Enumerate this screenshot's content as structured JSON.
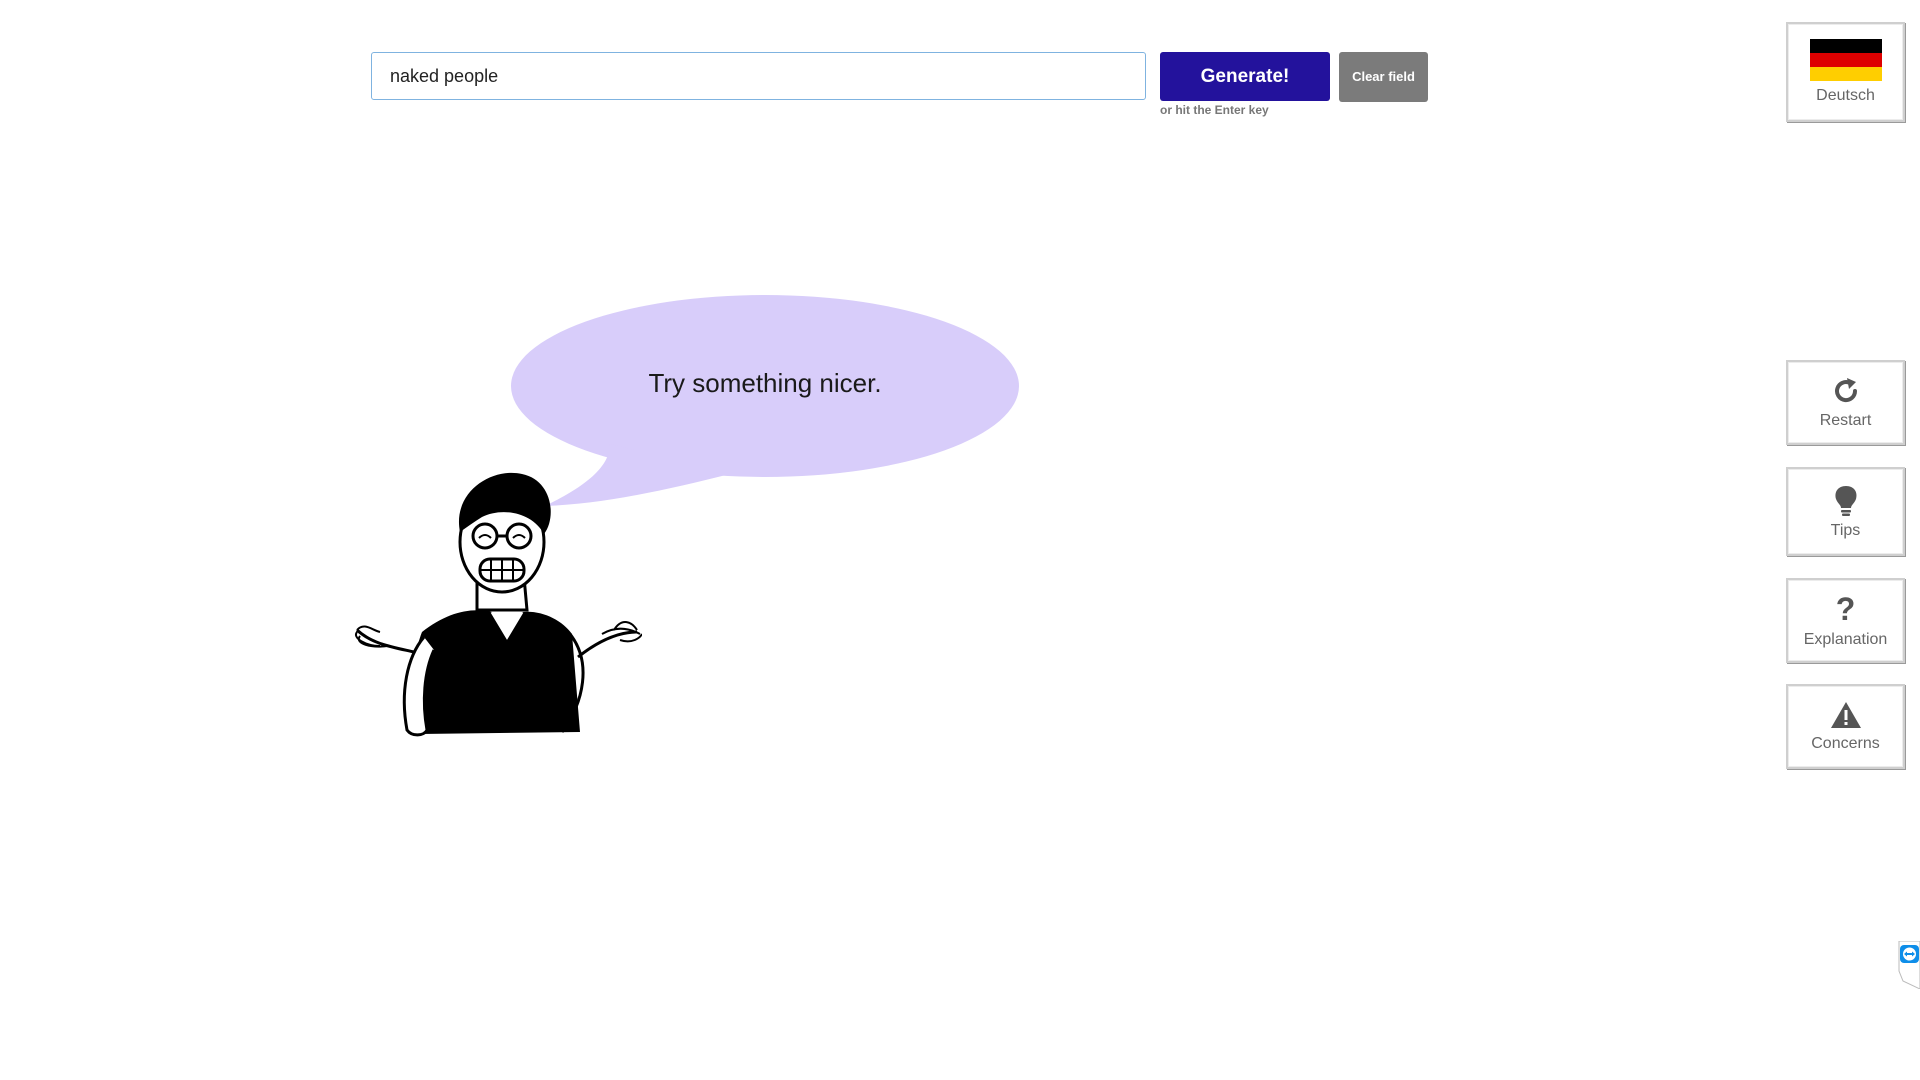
{
  "search": {
    "value": "naked people",
    "generate_label": "Generate!",
    "hint": "or hit the Enter key",
    "clear_label": "Clear field"
  },
  "bubble": {
    "message": "Try something nicer."
  },
  "sidebar": {
    "language": {
      "label": "Deutsch",
      "icon": "german-flag-icon",
      "flag_colors": [
        "#000000",
        "#dd0000",
        "#ffce00"
      ]
    },
    "items": [
      {
        "label": "Restart",
        "icon": "restart-icon"
      },
      {
        "label": "Tips",
        "icon": "lightbulb-icon"
      },
      {
        "label": "Explanation",
        "icon": "question-mark-icon"
      },
      {
        "label": "Concerns",
        "icon": "warning-icon"
      }
    ]
  },
  "colors": {
    "generate": "#23129c",
    "clear": "#7b7b7b",
    "bubble": "#d8cdfa",
    "input_border": "#7fb3e0"
  }
}
